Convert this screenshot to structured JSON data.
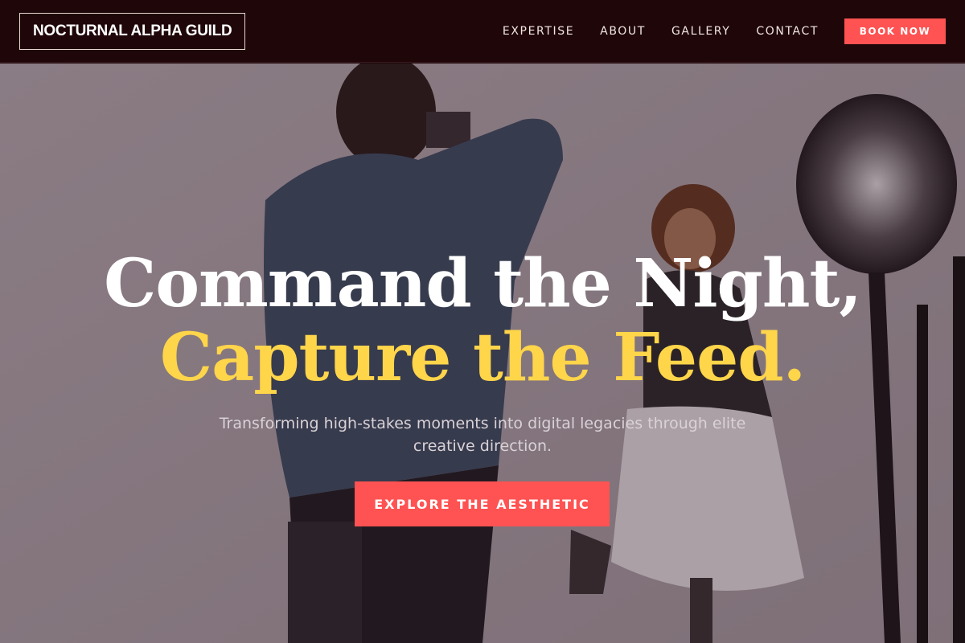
{
  "brand": {
    "name": "NOCTURNAL ALPHA GUILD"
  },
  "nav": {
    "items": [
      {
        "label": "EXPERTISE"
      },
      {
        "label": "ABOUT"
      },
      {
        "label": "GALLERY"
      },
      {
        "label": "CONTACT"
      }
    ],
    "cta_label": "BOOK NOW"
  },
  "hero": {
    "headline_line1": "Command the Night,",
    "headline_line2": "Capture the Feed.",
    "subtitle": "Transforming high-stakes moments into digital legacies through elite creative direction.",
    "cta_label": "EXPLORE THE AESTHETIC",
    "background_image": "photographer shooting a smiling woman in a studio"
  },
  "colors": {
    "nav_background": "#1f0609",
    "accent": "#ff5252",
    "headline_highlight": "#ffd54a",
    "headline_primary": "#ffffff"
  }
}
